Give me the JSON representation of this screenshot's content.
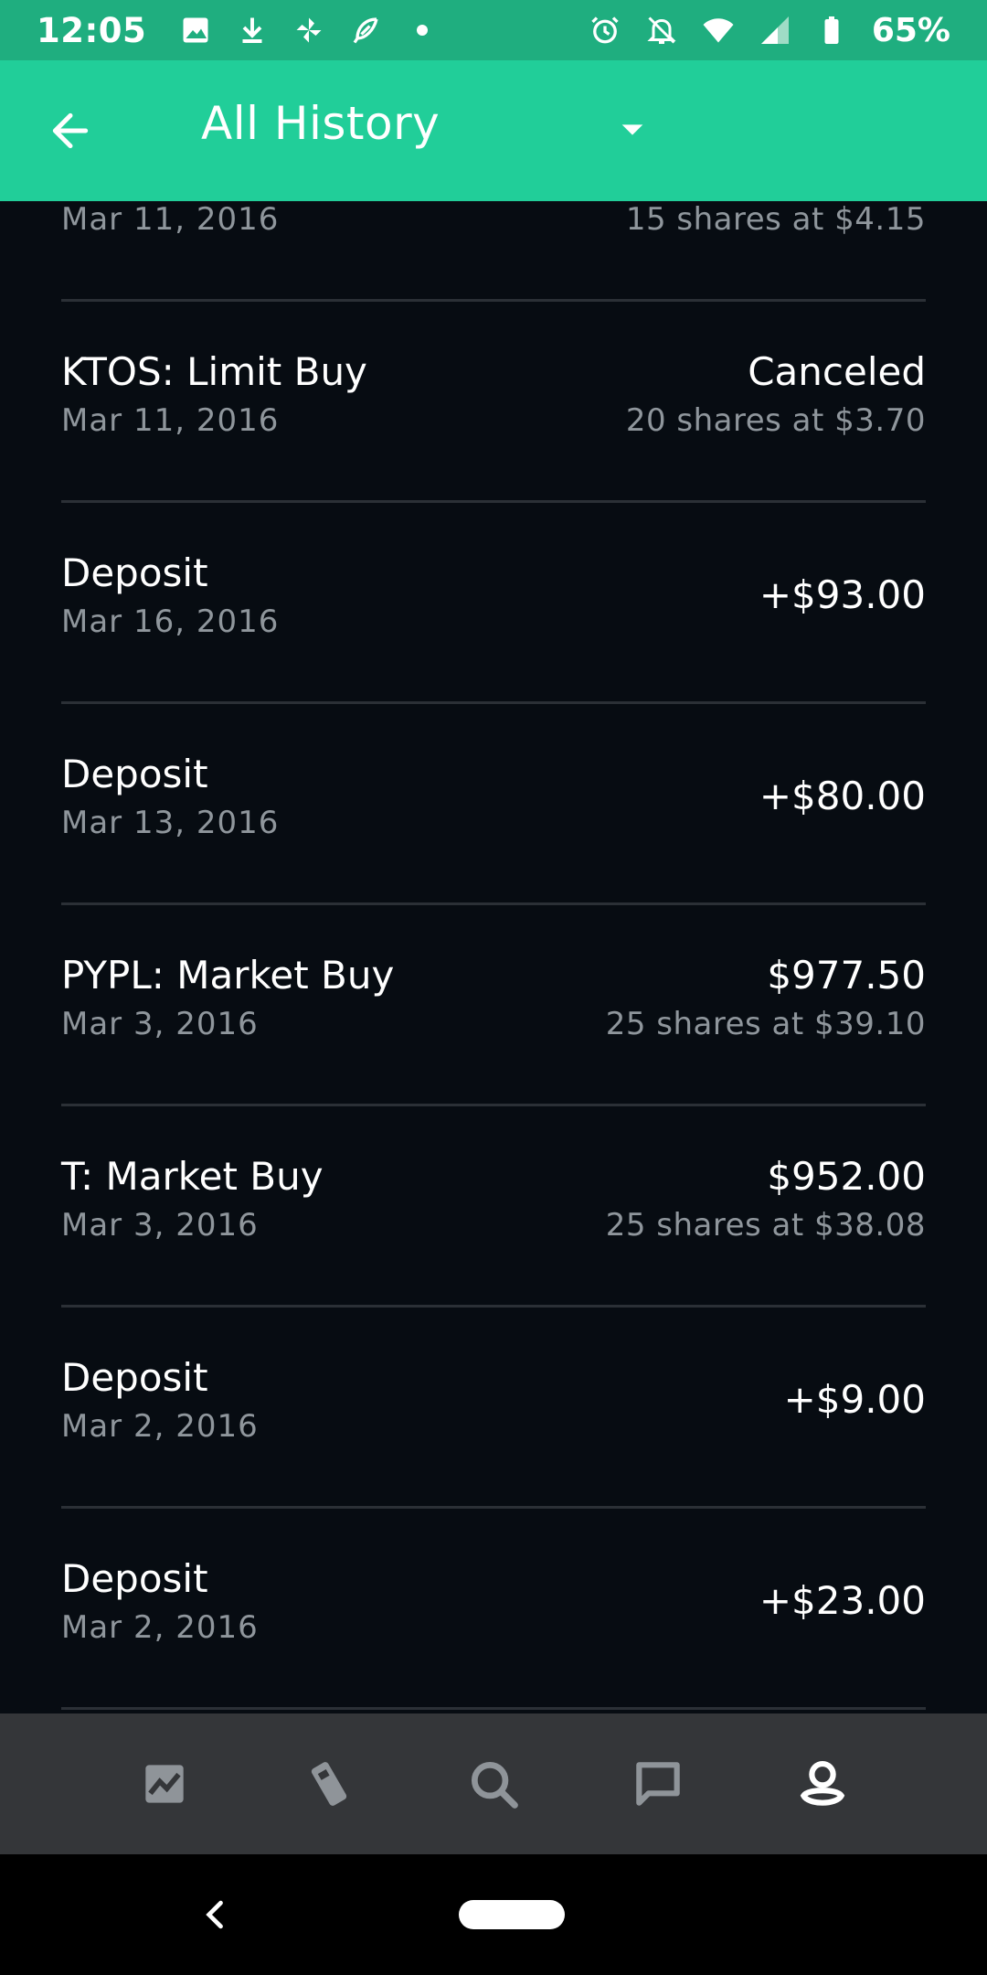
{
  "status_bar": {
    "time": "12:05",
    "battery": "65%",
    "left_icons": [
      "image-icon",
      "download-icon",
      "pinwheel-icon",
      "feather-icon",
      "dot-icon"
    ],
    "right_icons": [
      "alarm-icon",
      "notifications-off-icon",
      "wifi-icon",
      "signal-icon",
      "battery-icon"
    ]
  },
  "app_bar": {
    "title": "All History",
    "back_icon": "arrow-left-icon",
    "dropdown_icon": "caret-down-icon",
    "color": "#21ce99"
  },
  "history": [
    {
      "title": "",
      "date": "Mar 11, 2016",
      "amount": "",
      "detail": "15 shares at $4.15"
    },
    {
      "title": "KTOS: Limit Buy",
      "date": "Mar 11, 2016",
      "amount": "Canceled",
      "detail": "20 shares at $3.70"
    },
    {
      "title": "Deposit",
      "date": "Mar 16, 2016",
      "amount": "+$93.00",
      "detail": ""
    },
    {
      "title": "Deposit",
      "date": "Mar 13, 2016",
      "amount": "+$80.00",
      "detail": ""
    },
    {
      "title": "PYPL: Market Buy",
      "date": "Mar 3, 2016",
      "amount": "$977.50",
      "detail": "25 shares at $39.10"
    },
    {
      "title": "T: Market Buy",
      "date": "Mar 3, 2016",
      "amount": "$952.00",
      "detail": "25 shares at $38.08"
    },
    {
      "title": "Deposit",
      "date": "Mar 2, 2016",
      "amount": "+$9.00",
      "detail": ""
    },
    {
      "title": "Deposit",
      "date": "Mar 2, 2016",
      "amount": "+$23.00",
      "detail": ""
    }
  ],
  "bottom_nav": {
    "items": [
      "chart-icon",
      "card-icon",
      "search-icon",
      "messages-icon",
      "account-icon"
    ],
    "active": "account-icon"
  },
  "system_nav": {
    "items": [
      "back-chevron-icon",
      "home-pill"
    ]
  }
}
